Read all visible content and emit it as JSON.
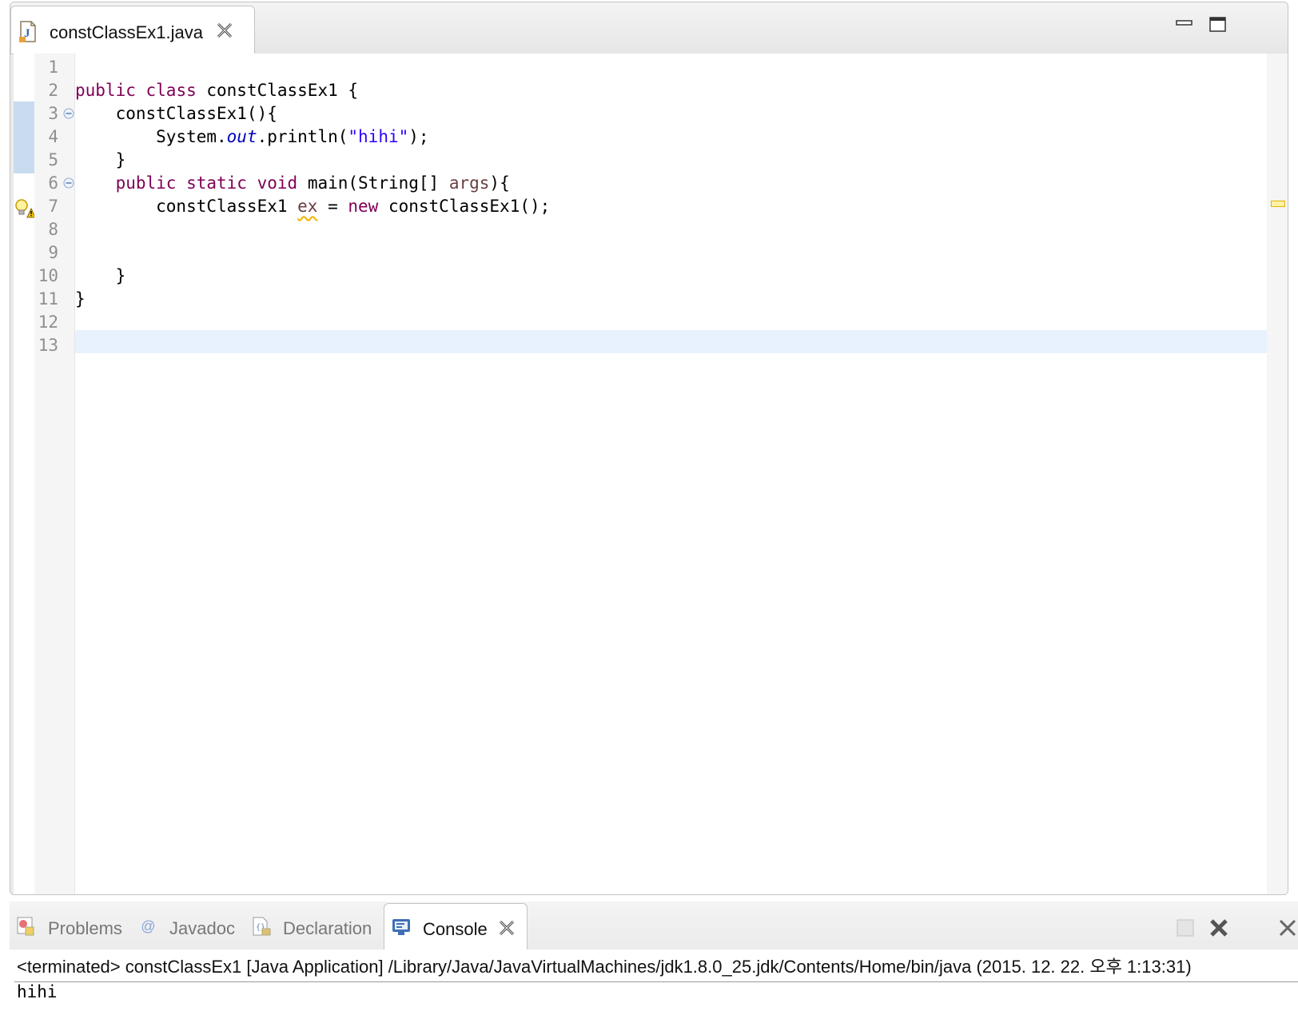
{
  "editor": {
    "tab_title": "constClassEx1.java",
    "lines": [
      {
        "num": "1",
        "tokens": []
      },
      {
        "num": "2",
        "tokens": [
          {
            "t": "public",
            "k": "kw"
          },
          {
            "t": " "
          },
          {
            "t": "class",
            "k": "kw"
          },
          {
            "t": " constClassEx1 {"
          }
        ]
      },
      {
        "num": "3",
        "tokens": [
          {
            "t": "    constClassEx1(){"
          }
        ]
      },
      {
        "num": "4",
        "tokens": [
          {
            "t": "        System."
          },
          {
            "t": "out",
            "k": "static-field"
          },
          {
            "t": ".println("
          },
          {
            "t": "\"hihi\"",
            "k": "str"
          },
          {
            "t": ");"
          }
        ]
      },
      {
        "num": "5",
        "tokens": [
          {
            "t": "    }"
          }
        ]
      },
      {
        "num": "6",
        "tokens": [
          {
            "t": "    "
          },
          {
            "t": "public",
            "k": "kw"
          },
          {
            "t": " "
          },
          {
            "t": "static",
            "k": "kw"
          },
          {
            "t": " "
          },
          {
            "t": "void",
            "k": "kw"
          },
          {
            "t": " main(String[] "
          },
          {
            "t": "args",
            "k": "param"
          },
          {
            "t": "){"
          }
        ]
      },
      {
        "num": "7",
        "tokens": [
          {
            "t": "        constClassEx1 "
          },
          {
            "t": "ex",
            "k": "warn-var"
          },
          {
            "t": " = "
          },
          {
            "t": "new",
            "k": "kw"
          },
          {
            "t": " constClassEx1();"
          }
        ]
      },
      {
        "num": "8",
        "tokens": []
      },
      {
        "num": "9",
        "tokens": []
      },
      {
        "num": "10",
        "tokens": [
          {
            "t": "    }"
          }
        ]
      },
      {
        "num": "11",
        "tokens": [
          {
            "t": "}"
          }
        ]
      },
      {
        "num": "12",
        "tokens": []
      },
      {
        "num": "13",
        "tokens": []
      }
    ]
  },
  "views": {
    "tabs": [
      {
        "label": "Problems",
        "icon": "problems-icon"
      },
      {
        "label": "Javadoc",
        "icon": "javadoc-icon"
      },
      {
        "label": "Declaration",
        "icon": "declaration-icon"
      },
      {
        "label": "Console",
        "icon": "console-icon",
        "active": true
      }
    ]
  },
  "console": {
    "status": "<terminated> constClassEx1 [Java Application] /Library/Java/JavaVirtualMachines/jdk1.8.0_25.jdk/Contents/Home/bin/java (2015. 12. 22. 오후 1:13:31)",
    "output": "hihi"
  },
  "colors": {
    "keyword": "#7f0055",
    "string": "#2a00ff",
    "static_field": "#0000c0",
    "parameter": "#6a3e3e",
    "current_line": "#e8f2fe",
    "warning": "#f2b400"
  }
}
